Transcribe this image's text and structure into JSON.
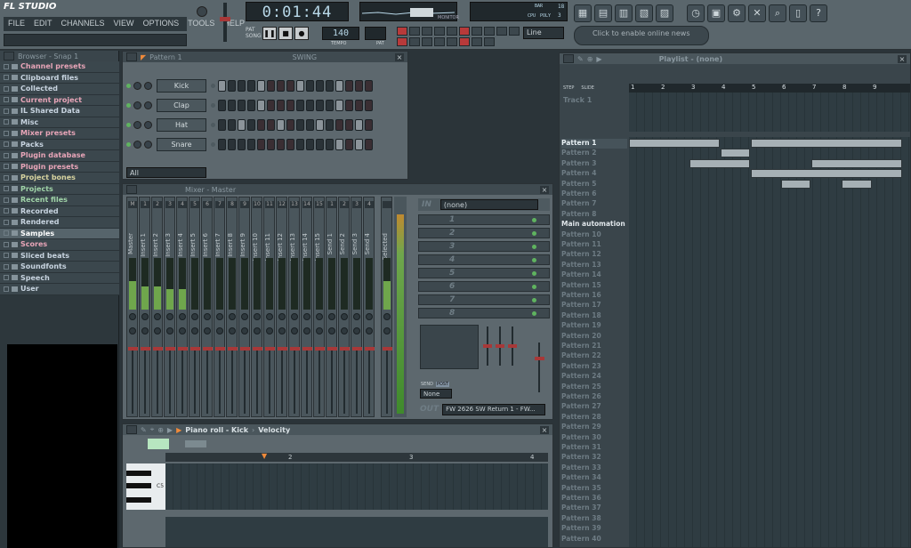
{
  "app": {
    "title": "FL STUDIO"
  },
  "menu": [
    "FILE",
    "EDIT",
    "CHANNELS",
    "VIEW",
    "OPTIONS",
    "TOOLS",
    "HELP"
  ],
  "transport": {
    "time": "0:01:44",
    "pat_label": "PAT",
    "song_label": "SONG",
    "tempo_label": "TEMPO",
    "pat_sm": "PAT",
    "bars_label": "BAR",
    "cpu_label": "CPU",
    "poly_label": "POLY",
    "bars_value": "18",
    "cpu_value": "3",
    "monitor_label": "MONITOR",
    "line_mode": "Line",
    "news": "Click to enable online news"
  },
  "browser": {
    "title": "Browser - Snap 1",
    "items": [
      {
        "label": "Channel presets",
        "color": "#e8a5b8"
      },
      {
        "label": "Clipboard files",
        "color": "#c8d4e0"
      },
      {
        "label": "Collected",
        "color": "#c8d4e0"
      },
      {
        "label": "Current project",
        "color": "#e8a5b8"
      },
      {
        "label": "IL Shared Data",
        "color": "#c8d4e0"
      },
      {
        "label": "Misc",
        "color": "#c8d4e0"
      },
      {
        "label": "Mixer presets",
        "color": "#e8a5b8"
      },
      {
        "label": "Packs",
        "color": "#c8d4e0"
      },
      {
        "label": "Plugin database",
        "color": "#e8a5b8"
      },
      {
        "label": "Plugin presets",
        "color": "#e8a5b8"
      },
      {
        "label": "Project bones",
        "color": "#d8d4a0"
      },
      {
        "label": "Projects",
        "color": "#a0d4a8"
      },
      {
        "label": "Recent files",
        "color": "#a0d4a8"
      },
      {
        "label": "Recorded",
        "color": "#c8d4e0"
      },
      {
        "label": "Rendered",
        "color": "#c8d4e0"
      },
      {
        "label": "Samples",
        "color": "#ffffff"
      },
      {
        "label": "Scores",
        "color": "#e8a5b8"
      },
      {
        "label": "Sliced beats",
        "color": "#c8d4e0"
      },
      {
        "label": "Soundfonts",
        "color": "#c8d4e0"
      },
      {
        "label": "Speech",
        "color": "#c8d4e0"
      },
      {
        "label": "User",
        "color": "#c8d4e0"
      }
    ]
  },
  "channel_rack": {
    "title": "Pattern 1",
    "swing_label": "SWING",
    "filter": "All",
    "channels": [
      {
        "name": "Kick",
        "steps": [
          1,
          0,
          0,
          0,
          1,
          0,
          0,
          0,
          1,
          0,
          0,
          0,
          1,
          0,
          0,
          0
        ]
      },
      {
        "name": "Clap",
        "steps": [
          0,
          0,
          0,
          0,
          1,
          0,
          0,
          0,
          0,
          0,
          0,
          0,
          1,
          0,
          0,
          0
        ]
      },
      {
        "name": "Hat",
        "steps": [
          0,
          0,
          1,
          0,
          0,
          0,
          1,
          0,
          0,
          0,
          1,
          0,
          0,
          0,
          1,
          0
        ]
      },
      {
        "name": "Snare",
        "steps": [
          0,
          0,
          0,
          0,
          0,
          0,
          0,
          0,
          0,
          0,
          0,
          0,
          1,
          0,
          1,
          0
        ]
      }
    ]
  },
  "mixer": {
    "title": "Mixer - Master",
    "input": "(none)",
    "in_label": "IN",
    "out_label": "OUT",
    "output": "FW 2626 SW Return 1 - FW...",
    "sends_label": "SEND",
    "post_label": "POST",
    "none_label": "None",
    "tracks": [
      {
        "num": "M",
        "name": "Master",
        "level": 0.55
      },
      {
        "num": "1",
        "name": "Insert 1",
        "level": 0.45
      },
      {
        "num": "2",
        "name": "Insert 2",
        "level": 0.45
      },
      {
        "num": "3",
        "name": "Insert 3",
        "level": 0.4
      },
      {
        "num": "4",
        "name": "Insert 4",
        "level": 0.4
      },
      {
        "num": "5",
        "name": "Insert 5",
        "level": 0
      },
      {
        "num": "6",
        "name": "Insert 6",
        "level": 0
      },
      {
        "num": "7",
        "name": "Insert 7",
        "level": 0
      },
      {
        "num": "8",
        "name": "Insert 8",
        "level": 0
      },
      {
        "num": "9",
        "name": "Insert 9",
        "level": 0
      },
      {
        "num": "10",
        "name": "Insert 10",
        "level": 0
      },
      {
        "num": "11",
        "name": "Insert 11",
        "level": 0
      },
      {
        "num": "12",
        "name": "Insert 12",
        "level": 0
      },
      {
        "num": "13",
        "name": "Insert 13",
        "level": 0
      },
      {
        "num": "14",
        "name": "Insert 14",
        "level": 0
      },
      {
        "num": "15",
        "name": "Insert 15",
        "level": 0
      },
      {
        "num": "1",
        "name": "Send 1",
        "level": 0
      },
      {
        "num": "2",
        "name": "Send 2",
        "level": 0
      },
      {
        "num": "3",
        "name": "Send 3",
        "level": 0
      },
      {
        "num": "4",
        "name": "Send 4",
        "level": 0
      },
      {
        "num": "",
        "name": "Selected",
        "level": 0.55
      }
    ],
    "fx_slots": [
      "1",
      "2",
      "3",
      "4",
      "5",
      "6",
      "7",
      "8"
    ]
  },
  "piano_roll": {
    "title": "Piano roll - Kick",
    "param": "Velocity",
    "bars": [
      "2",
      "3",
      "4"
    ],
    "note_label": "C5"
  },
  "playlist": {
    "title": "Playlist - (none)",
    "step_label": "STEP",
    "slide_label": "SLIDE",
    "track": "Track 1",
    "bars": [
      "1",
      "2",
      "3",
      "4",
      "5",
      "6",
      "7",
      "8",
      "9"
    ],
    "patterns": [
      "Pattern 1",
      "Pattern 2",
      "Pattern 3",
      "Pattern 4",
      "Pattern 5",
      "Pattern 6",
      "Pattern 7",
      "Pattern 8",
      "Main automation",
      "Pattern 10",
      "Pattern 11",
      "Pattern 12",
      "Pattern 13",
      "Pattern 14",
      "Pattern 15",
      "Pattern 16",
      "Pattern 17",
      "Pattern 18",
      "Pattern 19",
      "Pattern 20",
      "Pattern 21",
      "Pattern 22",
      "Pattern 23",
      "Pattern 24",
      "Pattern 25",
      "Pattern 26",
      "Pattern 27",
      "Pattern 28",
      "Pattern 29",
      "Pattern 30",
      "Pattern 31",
      "Pattern 32",
      "Pattern 33",
      "Pattern 34",
      "Pattern 35",
      "Pattern 36",
      "Pattern 37",
      "Pattern 38",
      "Pattern 39",
      "Pattern 40"
    ],
    "blocks": [
      {
        "row": 0,
        "start": 0,
        "len": 3
      },
      {
        "row": 0,
        "start": 4,
        "len": 5
      },
      {
        "row": 1,
        "start": 3,
        "len": 1
      },
      {
        "row": 2,
        "start": 2,
        "len": 2
      },
      {
        "row": 2,
        "start": 6,
        "len": 3
      },
      {
        "row": 3,
        "start": 4,
        "len": 5
      },
      {
        "row": 4,
        "start": 5,
        "len": 1
      },
      {
        "row": 4,
        "start": 7,
        "len": 1
      }
    ]
  }
}
